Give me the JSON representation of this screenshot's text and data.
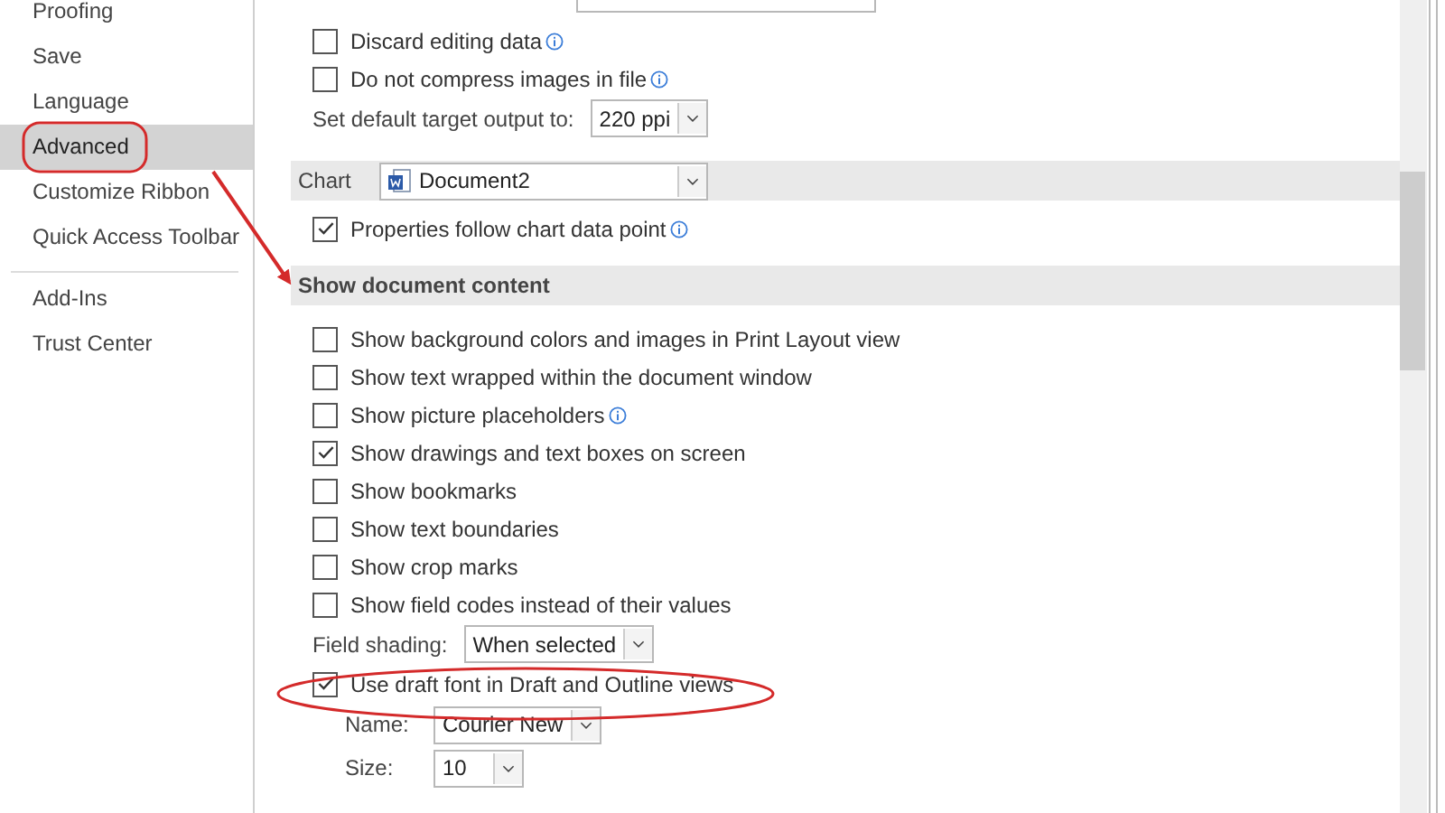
{
  "sidebar": {
    "groups": [
      [
        {
          "label": "Proofing",
          "selected": false
        },
        {
          "label": "Save",
          "selected": false
        },
        {
          "label": "Language",
          "selected": false
        },
        {
          "label": "Advanced",
          "selected": true
        },
        {
          "label": "Customize Ribbon",
          "selected": false
        },
        {
          "label": "Quick Access Toolbar",
          "selected": false
        }
      ],
      [
        {
          "label": "Add-Ins",
          "selected": false
        },
        {
          "label": "Trust Center",
          "selected": false
        }
      ]
    ]
  },
  "options": [
    {
      "kind": "checkbox",
      "label": "Discard editing data",
      "checked": false,
      "info": true
    },
    {
      "kind": "checkbox",
      "label": "Do not compress images in file",
      "checked": false,
      "info": true
    },
    {
      "kind": "select",
      "label": "Set default target output to:",
      "value": "220 ppi"
    },
    {
      "kind": "section_select",
      "label": "Chart",
      "value": "Document2"
    },
    {
      "kind": "checkbox",
      "label": "Properties follow chart data point",
      "checked": true,
      "info": true
    },
    {
      "kind": "section",
      "label": "Show document content"
    },
    {
      "kind": "checkbox",
      "label": "Show background colors and images in Print Layout view",
      "checked": false,
      "info": false
    },
    {
      "kind": "checkbox",
      "label": "Show text wrapped within the document window",
      "checked": false,
      "info": false
    },
    {
      "kind": "checkbox",
      "label": "Show picture placeholders",
      "checked": false,
      "info": true
    },
    {
      "kind": "checkbox",
      "label": "Show drawings and text boxes on screen",
      "checked": true,
      "info": false
    },
    {
      "kind": "checkbox",
      "label": "Show bookmarks",
      "checked": false,
      "info": false
    },
    {
      "kind": "checkbox",
      "label": "Show text boundaries",
      "checked": false,
      "info": false
    },
    {
      "kind": "checkbox",
      "label": "Show crop marks",
      "checked": false,
      "info": false
    },
    {
      "kind": "checkbox",
      "label": "Show field codes instead of their values",
      "checked": false,
      "info": false
    },
    {
      "kind": "select",
      "label": "Field shading:",
      "value": "When selected"
    },
    {
      "kind": "checkbox",
      "label": "Use draft font in Draft and Outline views",
      "checked": true,
      "info": false,
      "children": [
        {
          "kind": "select",
          "label": "Name:",
          "value": "Courier New"
        },
        {
          "kind": "select",
          "label": "Size:",
          "value": "10"
        }
      ]
    }
  ]
}
